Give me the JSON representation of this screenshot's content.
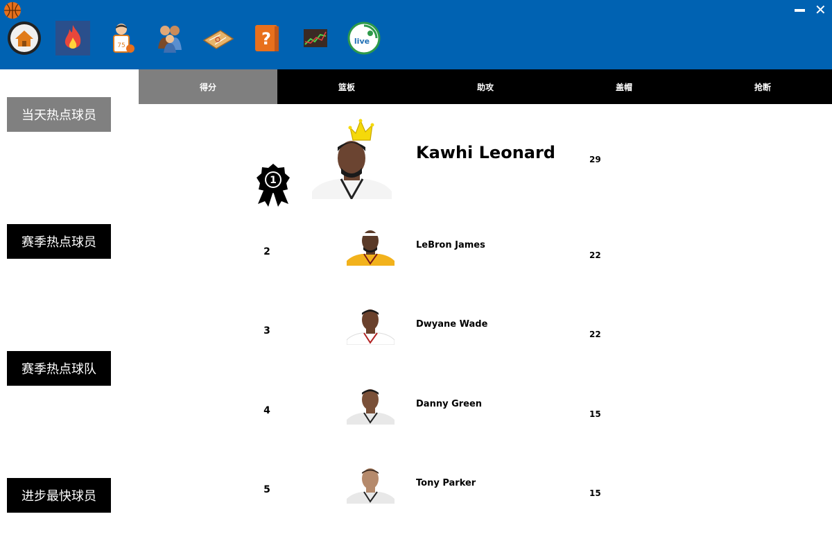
{
  "header": {
    "nav_icons": [
      {
        "name": "home-icon"
      },
      {
        "name": "hot-fire-icon"
      },
      {
        "name": "player-icon"
      },
      {
        "name": "team-icon"
      },
      {
        "name": "tactics-board-icon"
      },
      {
        "name": "help-book-icon"
      },
      {
        "name": "stock-chart-icon"
      },
      {
        "name": "live-icon"
      }
    ],
    "live_label": "live",
    "player_jersey_number": "75",
    "help_symbol": "?"
  },
  "tabs": [
    "得分",
    "篮板",
    "助攻",
    "盖帽",
    "抢断"
  ],
  "active_tab": "得分",
  "sidebar": [
    {
      "label": "当天热点球员",
      "active": true
    },
    {
      "label": "赛季热点球员",
      "active": false
    },
    {
      "label": "赛季热点球队",
      "active": false
    },
    {
      "label": "进步最快球员",
      "active": false
    }
  ],
  "ranking": [
    {
      "rank": "1",
      "name": "Kawhi Leonard",
      "score": "29",
      "jersey": "#ffffff",
      "skin": "#6b4431"
    },
    {
      "rank": "2",
      "name": "LeBron James",
      "score": "22",
      "jersey": "#f2b21c",
      "skin": "#5a3a28"
    },
    {
      "rank": "3",
      "name": "Dwyane Wade",
      "score": "22",
      "jersey": "#ffffff",
      "skin": "#6a412c"
    },
    {
      "rank": "4",
      "name": "Danny Green",
      "score": "15",
      "jersey": "#e8e8e8",
      "skin": "#7a5038"
    },
    {
      "rank": "5",
      "name": "Tony Parker",
      "score": "15",
      "jersey": "#e8e8e8",
      "skin": "#b58a6c"
    }
  ],
  "colors": {
    "header_bg": "#0062b2",
    "tab_bar_bg": "#000000",
    "tab_active_bg": "#7f7f7f",
    "sidebar_btn_bg": "#000000",
    "sidebar_btn_active_bg": "#808080",
    "crown": "#f5d90a"
  }
}
